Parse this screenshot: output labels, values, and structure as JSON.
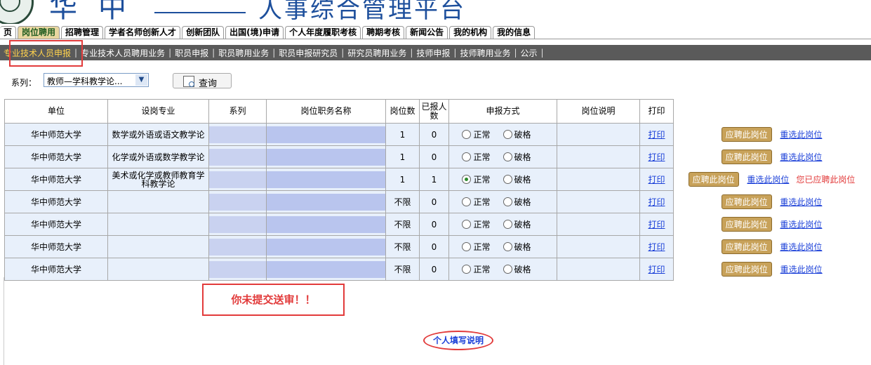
{
  "app": {
    "title": "人事综合管理平台",
    "brand_partial": "华中"
  },
  "nav": {
    "tabs": [
      "主页",
      "岗位聘用",
      "招聘管理",
      "学者名师创新人才",
      "创新团队",
      "出国(境)申请",
      "个人年度履职考核",
      "聘期考核",
      "新闻公告",
      "我的机构",
      "我的信息"
    ],
    "tab_home_partial": "页",
    "active_index": 1
  },
  "subnav": {
    "items": [
      "专业技术人员申报",
      "专业技术人员聘用业务",
      "职员申报",
      "职员聘用业务",
      "职员申报研究员",
      "研究员聘用业务",
      "技师申报",
      "技师聘用业务",
      "公示"
    ],
    "active_index": 0
  },
  "filter": {
    "label": "系列：",
    "selected": "教师—学科教学论...",
    "query_button": "查询"
  },
  "table": {
    "headers": {
      "unit": "单位",
      "major": "设岗专业",
      "series": "系列",
      "post": "岗位职务名称",
      "count": "岗位数",
      "applied": "已报人数",
      "mode": "申报方式",
      "desc": "岗位说明",
      "print": "打印"
    },
    "radio_normal": "正常",
    "radio_special": "破格",
    "print_label": "打印",
    "apply_label": "应聘此岗位",
    "reselect_label": "重选此岗位",
    "applied_message": "您已应聘此岗位",
    "rows": [
      {
        "unit": "华中师范大学",
        "major": "数学或外语或语文教学论",
        "count": "1",
        "applied": "0",
        "selected": "",
        "note": ""
      },
      {
        "unit": "华中师范大学",
        "major": "化学或外语或数学教学论",
        "count": "1",
        "applied": "0",
        "selected": "",
        "note": ""
      },
      {
        "unit": "华中师范大学",
        "major": "美术或化学或教师教育学科教学论",
        "count": "1",
        "applied": "1",
        "selected": "normal",
        "note": "您已应聘此岗位"
      },
      {
        "unit": "华中师范大学",
        "major": "",
        "count": "不限",
        "applied": "0",
        "selected": "",
        "note": ""
      },
      {
        "unit": "华中师范大学",
        "major": "",
        "count": "不限",
        "applied": "0",
        "selected": "",
        "note": ""
      },
      {
        "unit": "华中师范大学",
        "major": "",
        "count": "不限",
        "applied": "0",
        "selected": "",
        "note": ""
      },
      {
        "unit": "华中师范大学",
        "major": "",
        "count": "不限",
        "applied": "0",
        "selected": "",
        "note": ""
      }
    ]
  },
  "notice": {
    "not_submitted": "你未提交送审！！"
  },
  "help": {
    "label": "个人填写说明"
  },
  "colors": {
    "accent_red": "#e23b3b",
    "active_tab": "#e8d6a0",
    "link_blue": "#1a3fd8",
    "subnav_bg": "#5a5a5a"
  }
}
